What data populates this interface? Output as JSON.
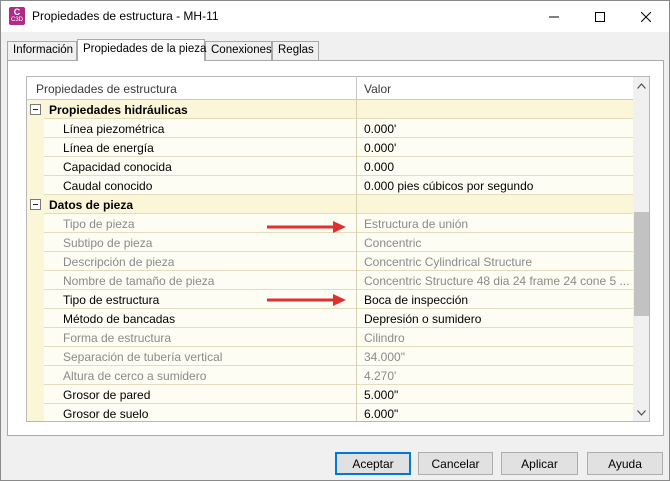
{
  "window": {
    "title": "Propiedades de estructura - MH-11",
    "app_icon": {
      "letter": "C",
      "badge": "C3D",
      "color": "#b02a8a"
    }
  },
  "tabs": [
    {
      "label": "Información",
      "active": false
    },
    {
      "label": "Propiedades de la pieza",
      "active": true
    },
    {
      "label": "Conexiones",
      "active": false
    },
    {
      "label": "Reglas",
      "active": false
    }
  ],
  "grid": {
    "columns": {
      "name": "Propiedades de estructura",
      "value": "Valor"
    },
    "categories": [
      {
        "label": "Propiedades hidráulicas",
        "rows": [
          {
            "name": "Línea piezométrica",
            "value": "0.000'",
            "editable": true
          },
          {
            "name": "Línea de energía",
            "value": "0.000'",
            "editable": true
          },
          {
            "name": "Capacidad conocida",
            "value": "0.000",
            "editable": true
          },
          {
            "name": "Caudal conocido",
            "value": "0.000 pies cúbicos por segundo",
            "editable": true
          }
        ]
      },
      {
        "label": "Datos de pieza",
        "rows": [
          {
            "name": "Tipo de pieza",
            "value": "Estructura de unión",
            "editable": false
          },
          {
            "name": "Subtipo de pieza",
            "value": "Concentric",
            "editable": false
          },
          {
            "name": "Descripción de pieza",
            "value": "Concentric Cylindrical Structure",
            "editable": false
          },
          {
            "name": "Nombre de tamaño de pieza",
            "value": "Concentric Structure 48 dia 24 frame 24 cone 5 ...",
            "editable": false
          },
          {
            "name": "Tipo de estructura",
            "value": "Boca de inspección",
            "editable": true
          },
          {
            "name": "Método de bancadas",
            "value": "Depresión o sumidero",
            "editable": true
          },
          {
            "name": "Forma de estructura",
            "value": "Cilindro",
            "editable": false
          },
          {
            "name": "Separación de tubería vertical",
            "value": "34.000\"",
            "editable": false
          },
          {
            "name": "Altura de cerco a sumidero",
            "value": "4.270'",
            "editable": false
          },
          {
            "name": "Grosor de pared",
            "value": "5.000\"",
            "editable": true
          },
          {
            "name": "Grosor de suelo",
            "value": "6.000\"",
            "editable": true
          }
        ]
      }
    ]
  },
  "annotations": {
    "arrow_color": "#e03131",
    "arrow_icon": "right-arrow-icon"
  },
  "buttons": {
    "ok": "Aceptar",
    "cancel": "Cancelar",
    "apply": "Aplicar",
    "help": "Ayuda"
  }
}
